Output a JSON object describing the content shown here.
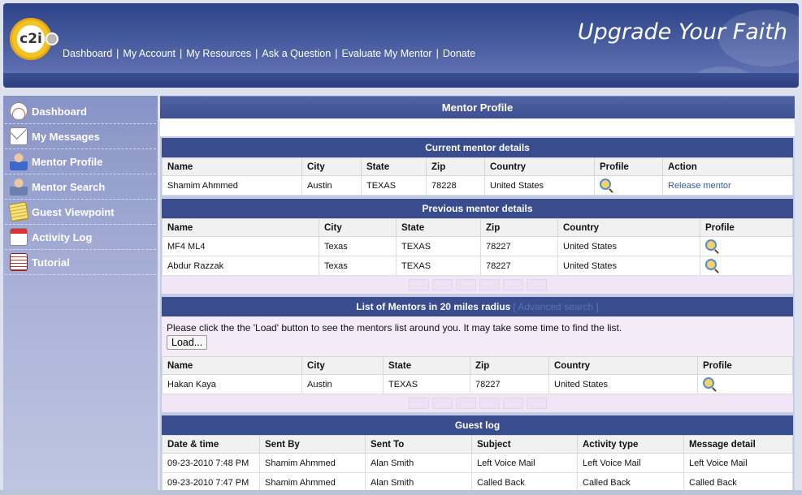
{
  "header": {
    "tagline": "Upgrade Your Faith",
    "logo_text": "c2i",
    "nav": [
      "Dashboard",
      "My Account",
      "My Resources",
      "Ask a Question",
      "Evaluate My Mentor",
      "Donate"
    ],
    "separator": "|"
  },
  "sidebar": {
    "items": [
      {
        "label": "Dashboard",
        "icon": "dashboard-gauge-icon"
      },
      {
        "label": "My Messages",
        "icon": "envelope-icon"
      },
      {
        "label": "Mentor Profile",
        "icon": "person-icon"
      },
      {
        "label": "Mentor Search",
        "icon": "person-search-icon"
      },
      {
        "label": "Guest Viewpoint",
        "icon": "notepad-icon"
      },
      {
        "label": "Activity Log",
        "icon": "calendar-icon"
      },
      {
        "label": "Tutorial",
        "icon": "book-icon"
      }
    ]
  },
  "main": {
    "title": "Mentor Profile",
    "current": {
      "heading": "Current mentor details",
      "columns": [
        "Name",
        "City",
        "State",
        "Zip",
        "Country",
        "Profile",
        "Action"
      ],
      "rows": [
        {
          "name": "Shamim  Ahmmed",
          "city": "Austin",
          "state": "TEXAS",
          "zip": "78228",
          "country": "United States",
          "action": "Release mentor"
        }
      ]
    },
    "previous": {
      "heading": "Previous mentor details",
      "columns": [
        "Name",
        "City",
        "State",
        "Zip",
        "Country",
        "Profile"
      ],
      "rows": [
        {
          "name": "MF4  ML4",
          "city": "Texas",
          "state": "TEXAS",
          "zip": "78227",
          "country": "United States"
        },
        {
          "name": "Abdur  Razzak",
          "city": "Texas",
          "state": "TEXAS",
          "zip": "78227",
          "country": "United States"
        }
      ]
    },
    "nearby": {
      "heading": "List of Mentors in 20 miles radius",
      "advanced_link": "[ Advanced search ]",
      "notice": "Please click the the 'Load' button to see the mentors list around you. It may take some time to find the list.",
      "load_button": "Load...",
      "columns": [
        "Name",
        "City",
        "State",
        "Zip",
        "Country",
        "Profile"
      ],
      "rows": [
        {
          "name": "Hakan  Kaya",
          "city": "Austin",
          "state": "TEXAS",
          "zip": "78227",
          "country": "United States"
        }
      ]
    },
    "guest_log": {
      "heading": "Guest log",
      "columns": [
        "Date & time",
        "Sent By",
        "Sent To",
        "Subject",
        "Activity type",
        "Message detail"
      ],
      "rows": [
        {
          "date": "09-23-2010 7:48 PM",
          "sent_by": "Shamim Ahmmed",
          "sent_to": "Alan Smith",
          "subject": "Left Voice Mail",
          "activity": "Left Voice Mail",
          "detail": "Left Voice Mail"
        },
        {
          "date": "09-23-2010 7:47 PM",
          "sent_by": "Shamim Ahmmed",
          "sent_to": "Alan Smith",
          "subject": "Called Back",
          "activity": "Called Back",
          "detail": "Called Back"
        }
      ]
    }
  },
  "colors": {
    "header_blue": "#3d4f92",
    "section_head": "#384c8e",
    "link": "#2d5aa7",
    "pager_bg": "#f0e6f5"
  }
}
